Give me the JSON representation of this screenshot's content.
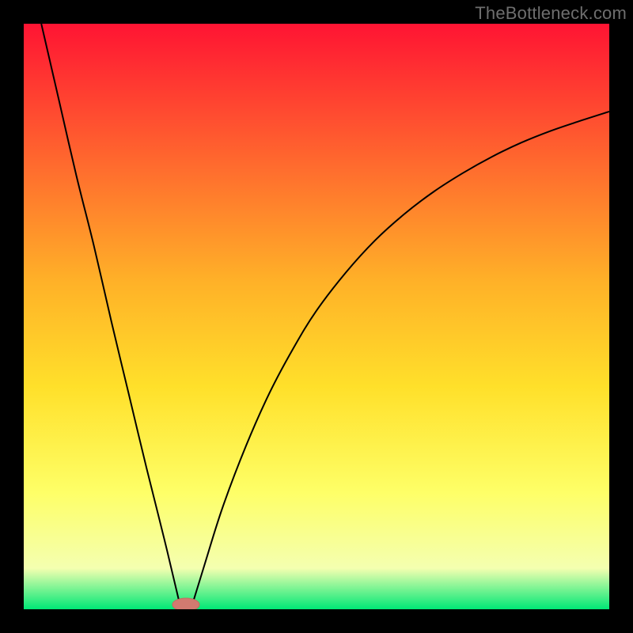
{
  "watermark": "TheBottleneck.com",
  "colors": {
    "frame": "#000000",
    "gradient_top": "#ff1433",
    "gradient_mid1": "#ff6a2e",
    "gradient_mid2": "#ffb128",
    "gradient_mid3": "#ffe02a",
    "gradient_low": "#feff67",
    "gradient_pale": "#f4ffb0",
    "gradient_green": "#00e876",
    "curve": "#000000",
    "marker_fill": "#d27a70",
    "marker_stroke": "#c56a60"
  },
  "chart_data": {
    "type": "line",
    "title": "",
    "xlabel": "",
    "ylabel": "",
    "xlim": [
      0,
      100
    ],
    "ylim": [
      0,
      100
    ],
    "series": [
      {
        "name": "left-branch",
        "x": [
          3,
          6,
          9,
          12,
          15,
          18,
          21,
          24,
          26.5
        ],
        "y": [
          100,
          87,
          74,
          62,
          49,
          36.5,
          24,
          12,
          1.5
        ]
      },
      {
        "name": "right-branch",
        "x": [
          29,
          31,
          34,
          38,
          42,
          46,
          50,
          55,
          60,
          65,
          70,
          75,
          80,
          85,
          90,
          95,
          100
        ],
        "y": [
          1.5,
          8,
          17.5,
          28,
          37,
          44.5,
          51,
          57.5,
          63,
          67.5,
          71.3,
          74.5,
          77.3,
          79.7,
          81.7,
          83.4,
          85
        ]
      }
    ],
    "marker": {
      "x": 27.7,
      "y": 0.8,
      "rx": 2.3,
      "ry": 1.1
    },
    "annotations": []
  }
}
